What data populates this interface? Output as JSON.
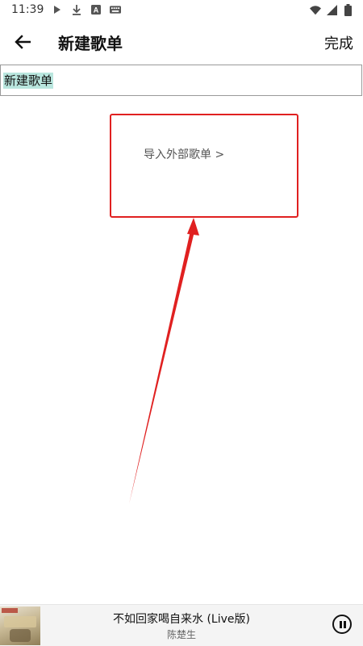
{
  "status_bar": {
    "time": "11:39",
    "left_icons": [
      "play-icon",
      "download-icon",
      "a-icon",
      "keyboard-icon"
    ],
    "right_icons": [
      "wifi-icon",
      "signal-icon",
      "battery-icon"
    ]
  },
  "header": {
    "title": "新建歌单",
    "done_label": "完成"
  },
  "playlist_name_input": {
    "value": "新建歌单"
  },
  "import": {
    "link_label": "导入外部歌单 >"
  },
  "now_playing": {
    "song_title": "不如回家喝自来水 (Live版)",
    "artist": "陈楚生"
  },
  "colors": {
    "annotation_red": "#e02020",
    "selection_highlight": "#b9e6de"
  }
}
